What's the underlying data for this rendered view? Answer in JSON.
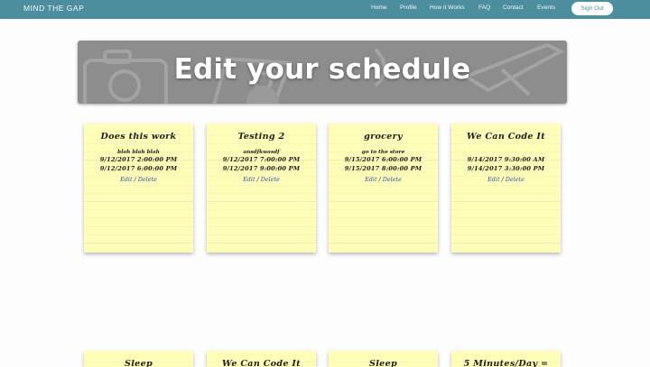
{
  "brand": "MIND THE GAP",
  "nav": {
    "items": [
      {
        "label": "Home"
      },
      {
        "label": "Profile"
      },
      {
        "label": "How it Works"
      },
      {
        "label": "FAQ"
      },
      {
        "label": "Contact"
      },
      {
        "label": "Events"
      }
    ],
    "sign_out": "Sign Out"
  },
  "hero": {
    "title": "Edit your schedule"
  },
  "events": [
    {
      "title": "Does this work",
      "description": "blah blah blah",
      "start": "9/12/2017 2:00:00 PM",
      "end": "9/12/2017 6:00:00 PM",
      "edit": "Edit",
      "separator": "/",
      "delete": "Delete"
    },
    {
      "title": "Testing 2",
      "description": "ansdfkwasdf",
      "start": "9/12/2017 7:00:00 PM",
      "end": "9/12/2017 9:00:00 PM",
      "edit": "Edit",
      "separator": "/",
      "delete": "Delete"
    },
    {
      "title": "grocery",
      "description": "go to the store",
      "start": "9/15/2017 6:00:00 PM",
      "end": "9/15/2017 8:00:00 PM",
      "edit": "Edit",
      "separator": "/",
      "delete": "Delete"
    },
    {
      "title": "We Can Code It",
      "description": "",
      "start": "9/14/2017 9:30:00 AM",
      "end": "9/14/2017 3:30:00 PM",
      "edit": "Edit",
      "separator": "/",
      "delete": "Delete"
    }
  ],
  "events_row2": [
    {
      "title": "Sleep"
    },
    {
      "title": "We Can Code It"
    },
    {
      "title": "Sleep"
    },
    {
      "title": "5 Minutes/Day ="
    }
  ],
  "colors": {
    "navbar": "#4c8e9e",
    "note": "#fefeb8",
    "link": "#2f4fa8",
    "hero": "#8d8d8d"
  }
}
